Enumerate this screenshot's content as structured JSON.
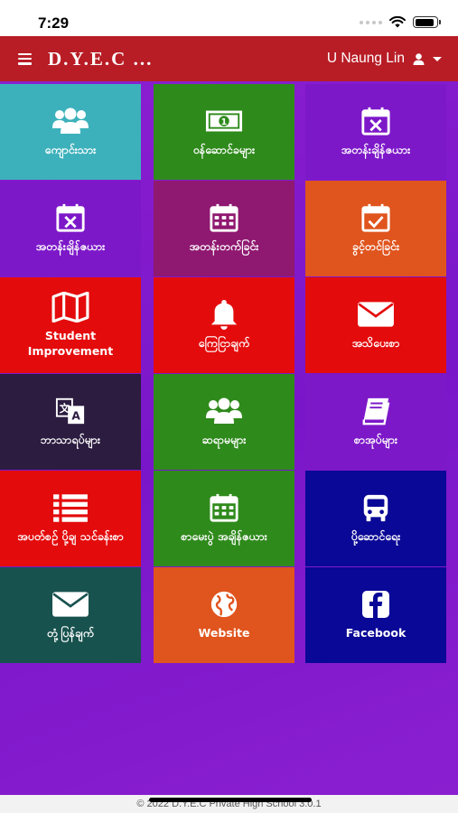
{
  "status_bar": {
    "time": "7:29",
    "battery_level": 0.9
  },
  "header": {
    "title": "D.Y.E.C ...",
    "user_name": "U Naung Lin"
  },
  "colors": {
    "header": "#b81d26",
    "background": "#7e18ca",
    "teal": "#3db1bb",
    "green": "#2f8a1c",
    "purple": "#7d18c9",
    "magenta": "#8f1870",
    "orange": "#e0541e",
    "red": "#e40b0c",
    "dark_purple": "#2c1c40",
    "navy": "#0a0896",
    "dark_teal": "#18524e"
  },
  "tiles": [
    {
      "name": "student",
      "label": "ကျောင်းသား",
      "icon": "users-icon",
      "color": "#3db1bb"
    },
    {
      "name": "fee",
      "label": "ဝန်ဆောင်ခများ",
      "icon": "money-icon",
      "color": "#2f8a1c"
    },
    {
      "name": "class-schedule",
      "label": "အတန်းချိန်ဇယား",
      "icon": "calendar-x-icon",
      "color": "#7d18c9"
    },
    {
      "name": "class-timetable",
      "label": "အတန်းချိန်ဇယား",
      "icon": "calendar-x-icon",
      "color": "#7d18c9"
    },
    {
      "name": "class-attendance",
      "label": "အတန်းတက်ခြင်း",
      "icon": "calendar-icon",
      "color": "#8f1870"
    },
    {
      "name": "leave",
      "label": "ခွင့်တင်ခြင်း",
      "icon": "calendar-check-icon",
      "color": "#e0541e"
    },
    {
      "name": "student-improvement",
      "label": "Student Improvement",
      "icon": "map-icon",
      "color": "#e40b0c"
    },
    {
      "name": "announcement",
      "label": "ကြေငြာချက်",
      "icon": "bell-icon",
      "color": "#e40b0c"
    },
    {
      "name": "message",
      "label": "အသိပေးစာ",
      "icon": "envelope-icon",
      "color": "#e40b0c"
    },
    {
      "name": "subjects",
      "label": "ဘာသာရပ်များ",
      "icon": "translate-icon",
      "color": "#2c1c40"
    },
    {
      "name": "teachers",
      "label": "ဆရာမများ",
      "icon": "users-icon",
      "color": "#2f8a1c"
    },
    {
      "name": "books",
      "label": "စာအုပ်များ",
      "icon": "book-icon",
      "color": "#7d18c9"
    },
    {
      "name": "registration",
      "label": "အပတ်စဉ် ပို့ချ သင်ခန်းစာ",
      "icon": "list-icon",
      "color": "#e40b0c"
    },
    {
      "name": "exam-schedule",
      "label": "စာမေးပွဲ အချိန်ဇယား",
      "icon": "calendar-icon",
      "color": "#2f8a1c"
    },
    {
      "name": "ferry",
      "label": "ပို့ဆောင်ရေး",
      "icon": "bus-icon",
      "color": "#0a0896"
    },
    {
      "name": "reply",
      "label": "တုံ့ပြန်ချက်",
      "icon": "envelope-icon",
      "color": "#18524e"
    },
    {
      "name": "website",
      "label": "Website",
      "icon": "globe-icon",
      "color": "#e0541e"
    },
    {
      "name": "facebook",
      "label": "Facebook",
      "icon": "facebook-icon",
      "color": "#0a0896"
    }
  ],
  "footer": {
    "copyright": "© 2022 D.Y.E.C Private High School 3.0.1"
  }
}
